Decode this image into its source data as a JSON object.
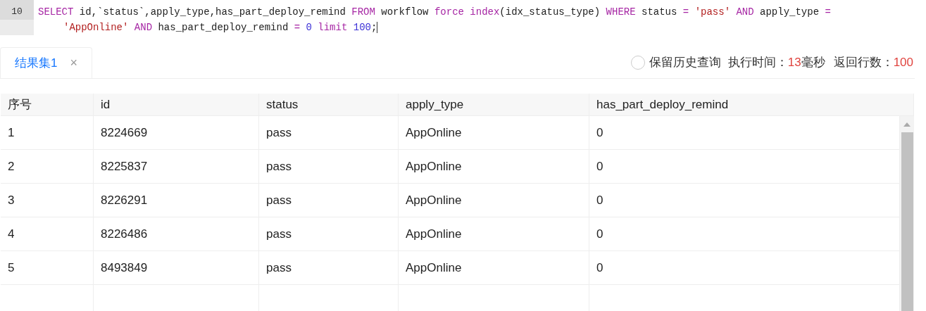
{
  "editor": {
    "line_number": "10",
    "rows": [
      {
        "tokens": [
          {
            "kind": "keyword",
            "text": "SELECT"
          },
          {
            "kind": "plain",
            "text": " id,`status`,apply_type,has_part_deploy_remind "
          },
          {
            "kind": "keyword",
            "text": "FROM"
          },
          {
            "kind": "plain",
            "text": " workflow "
          },
          {
            "kind": "keyword",
            "text": "force index"
          },
          {
            "kind": "plain",
            "text": "(idx_status_type) "
          },
          {
            "kind": "keyword",
            "text": "WHERE"
          },
          {
            "kind": "plain",
            "text": " status "
          },
          {
            "kind": "keyword",
            "text": "= "
          },
          {
            "kind": "string",
            "text": "'pass' "
          },
          {
            "kind": "keyword",
            "text": "AND"
          },
          {
            "kind": "plain",
            "text": " apply_type "
          },
          {
            "kind": "keyword",
            "text": "="
          }
        ]
      },
      {
        "tokens": [
          {
            "kind": "string",
            "text": "'AppOnline' "
          },
          {
            "kind": "keyword",
            "text": "AND"
          },
          {
            "kind": "plain",
            "text": " has_part_deploy_remind "
          },
          {
            "kind": "keyword",
            "text": "= "
          },
          {
            "kind": "number",
            "text": "0 "
          },
          {
            "kind": "keyword",
            "text": "limit "
          },
          {
            "kind": "number",
            "text": "100"
          },
          {
            "kind": "plain",
            "text": ";"
          }
        ]
      }
    ]
  },
  "tabs": [
    {
      "label": "结果集1",
      "selected": true,
      "close": "×"
    }
  ],
  "status": {
    "keep_history": {
      "label": "保留历史查询",
      "checked": false
    },
    "time_label": "执行时间：",
    "time_value": "13",
    "time_unit": "毫秒",
    "rows_label": "返回行数：",
    "rows_value": "100"
  },
  "table": {
    "columns": [
      "序号",
      "id",
      "status",
      "apply_type",
      "has_part_deploy_remind"
    ],
    "rows": [
      [
        "1",
        "8224669",
        "pass",
        "AppOnline",
        "0"
      ],
      [
        "2",
        "8225837",
        "pass",
        "AppOnline",
        "0"
      ],
      [
        "3",
        "8226291",
        "pass",
        "AppOnline",
        "0"
      ],
      [
        "4",
        "8226486",
        "pass",
        "AppOnline",
        "0"
      ],
      [
        "5",
        "8493849",
        "pass",
        "AppOnline",
        "0"
      ]
    ]
  }
}
